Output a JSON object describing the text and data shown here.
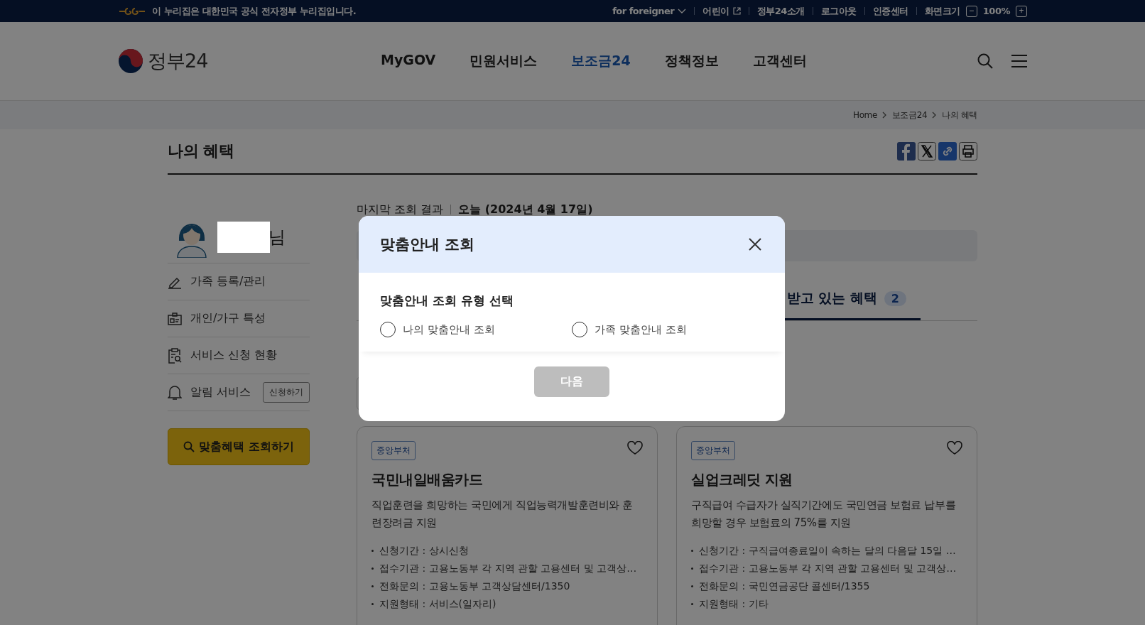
{
  "top_bar": {
    "notice": "이 누리집은 대한민국 공식 전자정부 누리집입니다.",
    "links": [
      {
        "label": "for foreigner",
        "kind": "dropdown"
      },
      {
        "label": "어린이",
        "kind": "external"
      },
      {
        "label": "정부24소개",
        "kind": "plain"
      },
      {
        "label": "로그아웃",
        "kind": "plain"
      },
      {
        "label": "인증센터",
        "kind": "plain"
      }
    ],
    "zoom": {
      "label": "화면크기",
      "decrease": "−",
      "value": "100%",
      "increase": "+"
    }
  },
  "header": {
    "logo": "정부24",
    "nav": [
      {
        "label": "MyGOV",
        "selected": false
      },
      {
        "label": "민원서비스",
        "selected": false
      },
      {
        "label": "보조금24",
        "selected": true
      },
      {
        "label": "정책정보",
        "selected": false
      },
      {
        "label": "고객센터",
        "selected": false
      }
    ]
  },
  "breadcrumb": [
    "Home",
    "보조금24",
    "나의 혜택"
  ],
  "page_title": "나의 혜택",
  "sidebar": {
    "user_suffix": "님",
    "items": [
      {
        "label": "가족 등록/관리",
        "kind": "pencil"
      },
      {
        "label": "개인/가구 특성",
        "kind": "card"
      },
      {
        "label": "서비스 신청 현황",
        "kind": "clipboard"
      },
      {
        "label": "알림 서비스",
        "kind": "bell",
        "button": "신청하기"
      }
    ],
    "search_button": "맞춤혜택 조회하기"
  },
  "main": {
    "last_result_label": "마지막 조회 결과",
    "last_result_date": "오늘 (2024년 4월 17일)",
    "tabs": [
      {
        "label": "받고 있는 혜택",
        "count": "2",
        "selected": true
      }
    ],
    "cards": [
      {
        "tag": "중앙부처",
        "title": "국민내일배움카드",
        "description": "직업훈련을 희망하는 국민에게 직업능력개발훈련비와 훈련장려금 지원",
        "details": [
          "신청기간 : 상시신청",
          "접수기관 : 고용노동부 각 지역 관할 고용센터 및 고객상…",
          "전화문의 : 고용노동부 고객상담센터/1350",
          "지원형태 : 서비스(일자리)"
        ]
      },
      {
        "tag": "중앙부처",
        "title": "실업크레딧 지원",
        "description": "구직급여 수급자가 실직기간에도 국민연금 보험료 납부를 희망할 경우 보험료의 75%를 지원",
        "details": [
          "신청기간 : 구직급여종료일이 속하는 달의 다음달 15일 …",
          "접수기관 : 고용노동부 각 지역 관할 고용센터 및 고객상…",
          "전화문의 : 국민연금공단 콜센터/1355",
          "지원형태 : 기타"
        ]
      }
    ]
  },
  "modal": {
    "title": "맞춤안내 조회",
    "section_title": "맞춤안내 조회 유형 선택",
    "options": [
      {
        "label": "나의 맞춤안내 조회",
        "selected": false
      },
      {
        "label": "가족 맞춤안내 조회",
        "selected": false
      }
    ],
    "next_button": {
      "label": "다음",
      "disabled": true
    }
  }
}
